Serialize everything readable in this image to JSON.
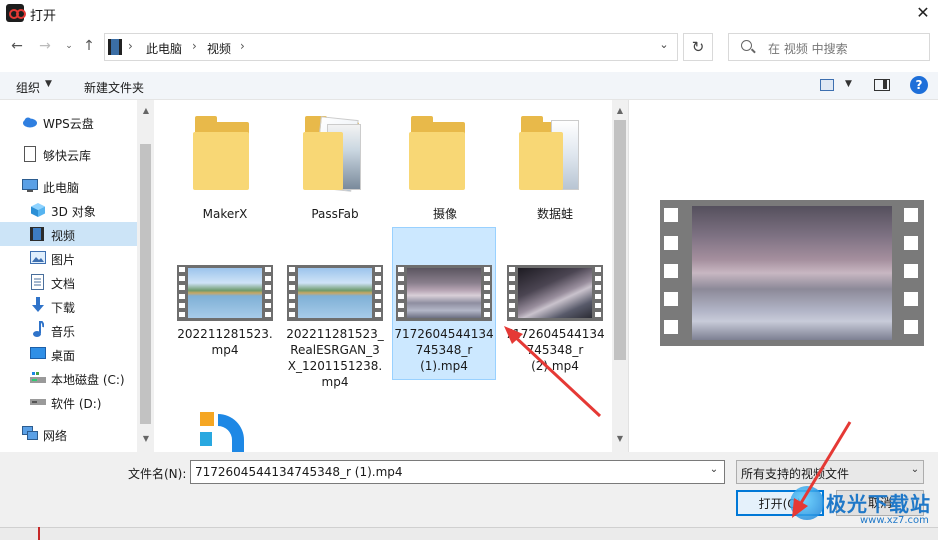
{
  "window": {
    "title": "打开"
  },
  "breadcrumb": [
    "此电脑",
    "视频"
  ],
  "search": {
    "placeholder": "在 视频 中搜索"
  },
  "toolbar": {
    "organize": "组织",
    "new_folder": "新建文件夹"
  },
  "sidebar": {
    "items": [
      {
        "label": "WPS云盘",
        "icon": "cloud-icon"
      },
      {
        "label": "够快云库",
        "icon": "document-icon"
      },
      {
        "label": "此电脑",
        "icon": "computer-icon"
      },
      {
        "label": "3D 对象",
        "icon": "cube-icon"
      },
      {
        "label": "视频",
        "icon": "video-icon",
        "selected": true
      },
      {
        "label": "图片",
        "icon": "picture-icon"
      },
      {
        "label": "文档",
        "icon": "document-icon"
      },
      {
        "label": "下载",
        "icon": "download-icon"
      },
      {
        "label": "音乐",
        "icon": "music-icon"
      },
      {
        "label": "桌面",
        "icon": "desktop-icon"
      },
      {
        "label": "本地磁盘 (C:)",
        "icon": "drive-icon"
      },
      {
        "label": "软件 (D:)",
        "icon": "drive-icon"
      },
      {
        "label": "网络",
        "icon": "network-icon"
      }
    ]
  },
  "files": {
    "folders": [
      {
        "name": "MakerX"
      },
      {
        "name": "PassFab"
      },
      {
        "name": "摄像"
      },
      {
        "name": "数据蛙"
      }
    ],
    "videos": [
      {
        "lines": [
          "202211281523.",
          "mp4"
        ]
      },
      {
        "lines": [
          "202211281523_",
          "RealESRGAN_3",
          "X_1201151238.",
          "mp4"
        ]
      },
      {
        "lines": [
          "7172604544134",
          "745348_r",
          "(1).mp4"
        ],
        "selected": true
      },
      {
        "lines": [
          "7172604544134",
          "745348_r",
          "(2).mp4"
        ]
      }
    ]
  },
  "footer": {
    "filename_label": "文件名(N):",
    "filename_value": "7172604544134745348_r (1).mp4",
    "filetype_value": "所有支持的视频文件",
    "open_label": "打开(O)",
    "cancel_label": "取消"
  },
  "watermark": {
    "title": "极光下载站",
    "url": "www.xz7.com"
  },
  "colors": {
    "accent": "#0078d7",
    "selection": "#cce8ff",
    "annotation": "#e53935"
  }
}
